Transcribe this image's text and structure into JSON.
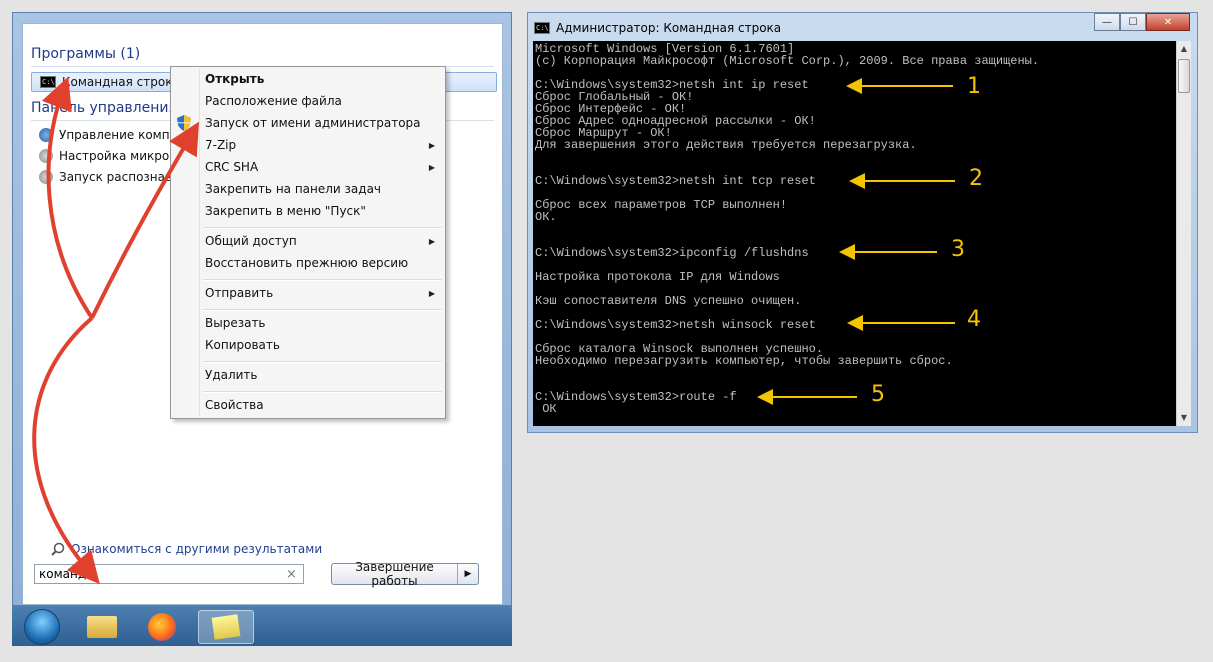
{
  "start_menu": {
    "programs_header": "Программы (1)",
    "programs": [
      {
        "label": "Командная строка",
        "icon": "cmd-icon",
        "selected": true
      }
    ],
    "control_panel_header": "Панель управления",
    "control_panel_items": [
      {
        "label": "Управление компь",
        "icon": "computer-management-icon"
      },
      {
        "label": "Настройка микроф",
        "icon": "microphone-icon"
      },
      {
        "label": "Запуск распознава",
        "icon": "speech-recognition-icon"
      }
    ],
    "more_results": "Ознакомиться с другими результатами",
    "search": {
      "value": "команд",
      "clear_glyph": "×"
    },
    "shutdown": {
      "label": "Завершение работы",
      "arrow": "▶"
    }
  },
  "taskbar": {
    "items": [
      {
        "name": "start-orb"
      },
      {
        "name": "explorer-icon"
      },
      {
        "name": "firefox-icon"
      },
      {
        "name": "sticky-notes-icon",
        "active": true
      }
    ]
  },
  "context_menu": {
    "items": [
      {
        "label": "Открыть",
        "bold": true
      },
      {
        "label": "Расположение файла"
      },
      {
        "label": "Запуск от имени администратора",
        "icon": "uac-shield-icon"
      },
      {
        "label": "7-Zip",
        "submenu": true
      },
      {
        "label": "CRC SHA",
        "submenu": true
      },
      {
        "label": "Закрепить на панели задач"
      },
      {
        "label": "Закрепить в меню \"Пуск\""
      },
      {
        "label": "Общий доступ",
        "submenu": true
      },
      {
        "label": "Восстановить прежнюю версию"
      },
      {
        "label": "Отправить",
        "submenu": true
      },
      {
        "label": "Вырезать"
      },
      {
        "label": "Копировать"
      },
      {
        "label": "Удалить"
      },
      {
        "label": "Свойства"
      }
    ],
    "submenu_glyph": "▶"
  },
  "console": {
    "title": "Администратор: Командная строка",
    "title_icon_text": "C:\\",
    "buttons": {
      "minimize": "—",
      "maximize": "☐",
      "close": "✕"
    },
    "lines": [
      "Microsoft Windows [Version 6.1.7601]",
      "(c) Корпорация Майкрософт (Microsoft Corp.), 2009. Все права защищены.",
      "",
      "C:\\Windows\\system32>netsh int ip reset",
      "Сброс Глобальный - ОК!",
      "Сброс Интерфейс - ОК!",
      "Сброс Адрес одноадресной рассылки - ОК!",
      "Сброс Маршрут - ОК!",
      "Для завершения этого действия требуется перезагрузка.",
      "",
      "",
      "C:\\Windows\\system32>netsh int tcp reset",
      "",
      "Сброс всех параметров TCP выполнен!",
      "ОК.",
      "",
      "",
      "C:\\Windows\\system32>ipconfig /flushdns",
      "",
      "Настройка протокола IP для Windows",
      "",
      "Кэш сопоставителя DNS успешно очищен.",
      "",
      "C:\\Windows\\system32>netsh winsock reset",
      "",
      "Сброс каталога Winsock выполнен успешно.",
      "Необходимо перезагрузить компьютер, чтобы завершить сброс.",
      "",
      "",
      "C:\\Windows\\system32>route -f",
      " ОК"
    ],
    "scroll": {
      "up": "▲",
      "down": "▼"
    }
  },
  "annotations": {
    "step_numbers": [
      "1",
      "2",
      "3",
      "4",
      "5"
    ],
    "arrow_color": "#e0412f",
    "step_arrow_color": "#f5c400"
  }
}
